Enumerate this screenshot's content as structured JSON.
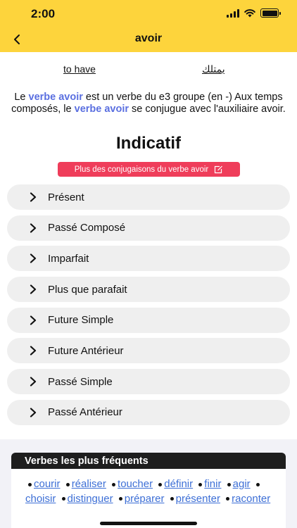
{
  "status": {
    "time": "2:00"
  },
  "nav": {
    "title": "avoir",
    "back_icon": "chevron-left-icon"
  },
  "translations": {
    "en": "to have",
    "ar": "يمتلك"
  },
  "description": {
    "p1": "Le ",
    "verb1": "verbe avoir",
    "p2": " est un verbe du e3 groupe (en -) Aux temps composés, le ",
    "verb2": "verbe avoir",
    "p3": " se conjugue avec l'auxiliaire avoir."
  },
  "section_title": "Indicatif",
  "more_button": {
    "label": "Plus des conjugaisons du verbe avoir",
    "icon": "edit-icon"
  },
  "tenses": [
    "Présent",
    "Passé Composé",
    "Imparfait",
    "Plus que parafait",
    "Future Simple",
    "Future Antérieur",
    "Passé Simple",
    "Passé Antérieur"
  ],
  "frequent": {
    "title": "Verbes les plus fréquents",
    "verbs": [
      "courir",
      "réaliser",
      "toucher",
      "définir",
      "finir",
      "agir",
      "choisir",
      "distinguer",
      "préparer",
      "présenter",
      "raconter"
    ]
  },
  "colors": {
    "accent": "#fdd43c",
    "button": "#ef3d5a",
    "link": "#3d6fd6",
    "highlight": "#5a6fe0"
  }
}
